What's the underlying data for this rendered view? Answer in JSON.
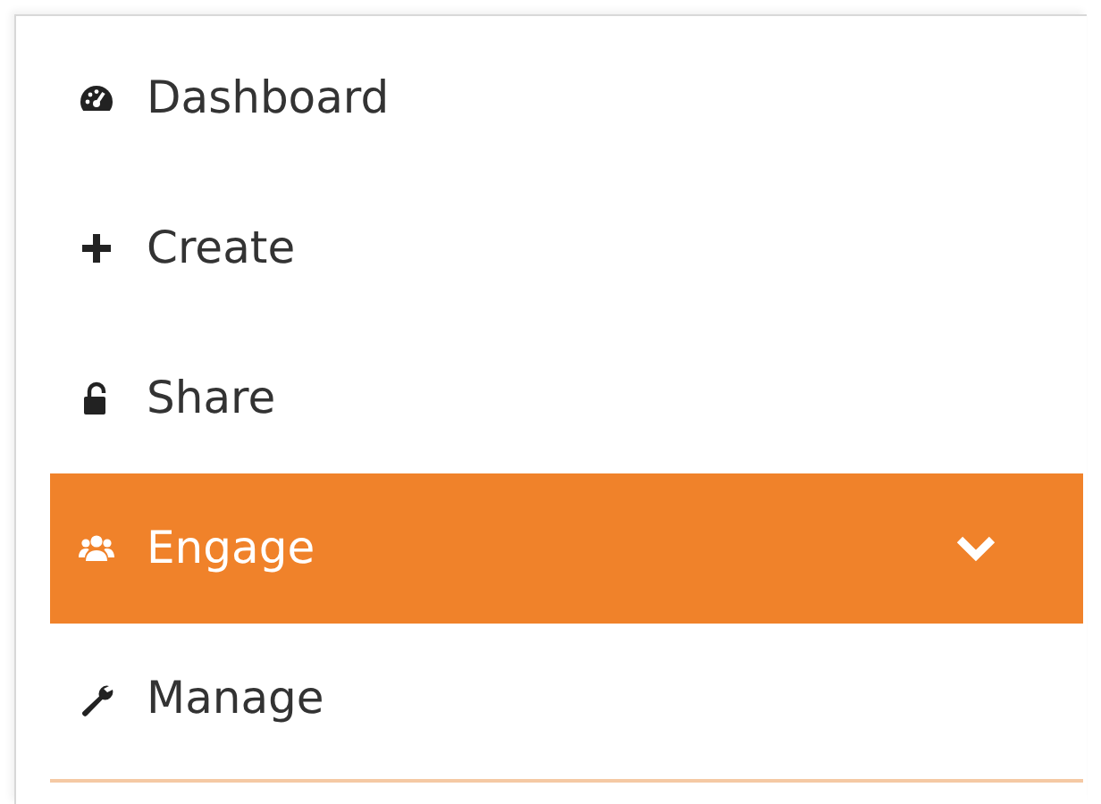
{
  "menu": {
    "items": [
      {
        "label": "Dashboard",
        "selected": false,
        "submenu": false
      },
      {
        "label": "Create",
        "selected": false,
        "submenu": false
      },
      {
        "label": "Share",
        "selected": false,
        "submenu": false
      },
      {
        "label": "Engage",
        "selected": true,
        "submenu": true
      },
      {
        "label": "Manage",
        "selected": false,
        "submenu": false
      }
    ]
  }
}
